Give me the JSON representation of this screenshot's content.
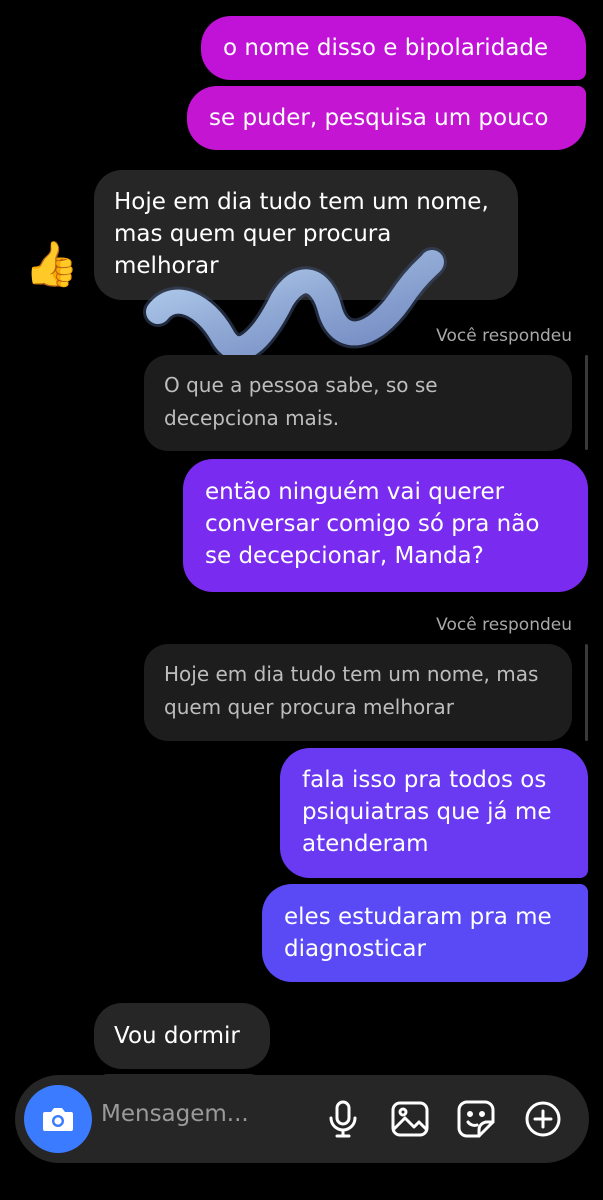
{
  "messages": {
    "m1": "o nome disso e bipolaridade",
    "m2": "se puder, pesquisa um pouco",
    "m3": "Hoje em dia tudo tem um nome, mas quem quer procura melhorar",
    "m4": "então ninguém vai querer conversar comigo só pra não se decepcionar, Manda?",
    "m5": "fala isso pra todos os psiquiatras que já me atenderam",
    "m6": "eles estudaram pra me diagnosticar",
    "m7": "Vou dormir"
  },
  "replies": {
    "label1": "Você respondeu",
    "quote1": "O que a pessoa sabe, so se decepciona mais.",
    "label2": "Você respondeu",
    "quote2": "Hoje em dia tudo tem um nome, mas quem quer procura melhorar"
  },
  "reaction_emoji": "👍",
  "composer": {
    "placeholder": "Mensagem...",
    "icons": [
      "camera-icon",
      "microphone-icon",
      "gallery-icon",
      "sticker-icon",
      "plus-icon"
    ]
  },
  "colors": {
    "bubble_magenta": "#c112d8",
    "bubble_purple": "#7a2bf0",
    "bubble_blue": "#5a4af5",
    "incoming": "#262626",
    "camera_button": "#3a7bff"
  }
}
